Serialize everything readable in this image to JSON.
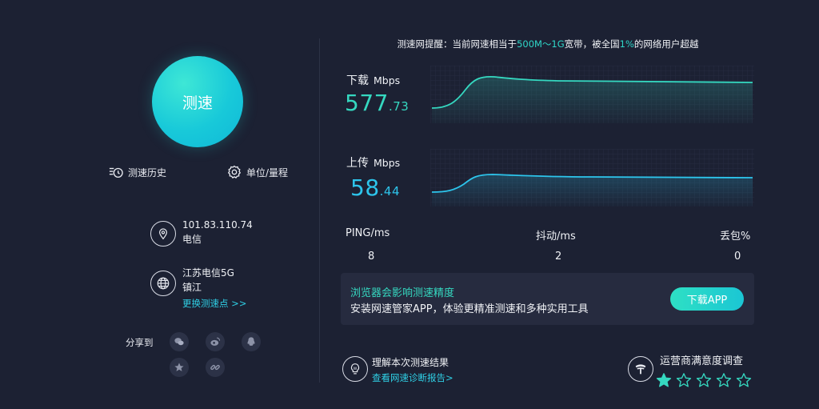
{
  "left": {
    "speed_button_label": "测速",
    "history_label": "测速历史",
    "unit_label": "单位/量程",
    "ip": "101.83.110.74",
    "isp": "电信",
    "server_name": "江苏电信5G",
    "server_city": "镇江",
    "change_server_link": "更换测速点 >>",
    "share_label": "分享到",
    "share_icons": [
      "wechat-icon",
      "weibo-icon",
      "qq-icon",
      "favorite-icon",
      "link-icon"
    ]
  },
  "notice": {
    "prefix": "测速网提醒：当前网速相当于",
    "bandwidth": "500M～1G",
    "middle": "宽带，被全国",
    "percent": "1%",
    "suffix": "的网络用户超越"
  },
  "download": {
    "label": "下载",
    "unit": "Mbps",
    "value_int": "577",
    "value_frac": ".73",
    "color": "#35d8c0"
  },
  "upload": {
    "label": "上传",
    "unit": "Mbps",
    "value_int": "58",
    "value_frac": ".44",
    "color": "#2dc5ec"
  },
  "stats": {
    "ping_label": "PING/ms",
    "ping_value": "8",
    "jitter_label": "抖动/ms",
    "jitter_value": "2",
    "loss_label": "丢包%",
    "loss_value": "0"
  },
  "banner": {
    "title": "浏览器会影响测速精度",
    "subtitle": "安装网速管家APP，体验更精准测速和多种实用工具",
    "button_label": "下载APP"
  },
  "bottom": {
    "result_title": "理解本次测速结果",
    "result_link": "查看网速诊断报告>",
    "survey_title": "运营商满意度调查",
    "rating": 1,
    "rating_max": 5
  },
  "colors": {
    "background": "#1c2133",
    "accent": "#35d8c0",
    "link": "#2fd0e6"
  }
}
